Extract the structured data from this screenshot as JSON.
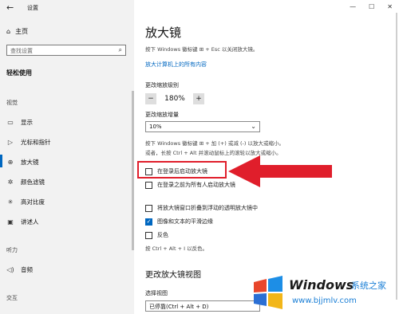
{
  "app": {
    "title": "设置"
  },
  "sidebar": {
    "home": "主页",
    "search_placeholder": "查找设置",
    "category": "轻松使用",
    "section_vision": "视觉",
    "items": [
      {
        "label": "显示",
        "icon": "monitor-icon"
      },
      {
        "label": "光标和指针",
        "icon": "pointer-icon"
      },
      {
        "label": "放大镜",
        "icon": "magnifier-icon"
      },
      {
        "label": "颜色滤镜",
        "icon": "color-filter-icon"
      },
      {
        "label": "高对比度",
        "icon": "contrast-icon"
      },
      {
        "label": "讲述人",
        "icon": "narrator-icon"
      }
    ],
    "section_hearing": "听力",
    "audio": "音频",
    "section_interaction": "交互"
  },
  "main": {
    "title": "放大镜",
    "intro": "按下 Windows 徽标键 ⊞ + Esc 以关闭放大镜。",
    "link": "放大计算机上的所有内容",
    "zoom_level_label": "更改缩放级别",
    "zoom_minus": "−",
    "zoom_value": "180%",
    "zoom_plus": "+",
    "zoom_increment_label": "更改缩放增量",
    "zoom_increment_value": "10%",
    "help_line1": "按下 Windows 徽标键 ⊞ + 加 (+) 或减 (-) 以放大或缩小。",
    "help_line2": "或者，长按 Ctrl + Alt 并滚动鼠标上的滚轮以放大或缩小。",
    "checkboxes": [
      {
        "label": "在登录后启动放大镜",
        "checked": false
      },
      {
        "label": "在登录之前为所有人启动放大镜",
        "checked": false
      },
      {
        "label": "将放大镜窗口折叠到浮动的透明放大镜中",
        "checked": false
      },
      {
        "label": "图像和文本的平滑边缘",
        "checked": true
      },
      {
        "label": "反色",
        "checked": false
      }
    ],
    "invert_help": "按 Ctrl + Alt + I 以反色。",
    "view_section": "更改放大镜视图",
    "view_label": "选择视图",
    "view_value": "已停靠(Ctrl + Alt + D)"
  },
  "watermark": {
    "brand": "Windows",
    "suffix": "系统之家",
    "url": "www.bjjmlv.com"
  },
  "colors": {
    "accent": "#0067c0",
    "highlight": "#e01e2b"
  }
}
